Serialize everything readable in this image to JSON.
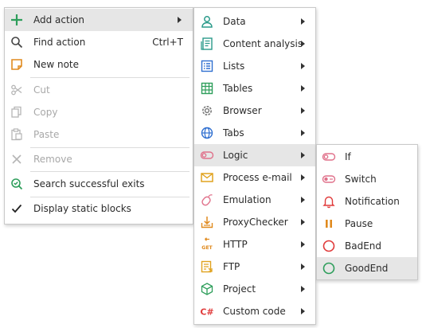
{
  "main_menu": {
    "add_action": "Add action",
    "find_action": "Find action",
    "find_action_shortcut": "Ctrl+T",
    "new_note": "New note",
    "cut": "Cut",
    "copy": "Copy",
    "paste": "Paste",
    "remove": "Remove",
    "search_successful_exits": "Search successful exits",
    "display_static_blocks": "Display static blocks"
  },
  "action_menu": {
    "items": [
      {
        "label": "Data",
        "icon": "person-icon"
      },
      {
        "label": "Content analysis",
        "icon": "document-analysis-icon"
      },
      {
        "label": "Lists",
        "icon": "list-icon"
      },
      {
        "label": "Tables",
        "icon": "table-icon"
      },
      {
        "label": "Browser",
        "icon": "gear-icon"
      },
      {
        "label": "Tabs",
        "icon": "globe-icon"
      },
      {
        "label": "Logic",
        "icon": "toggle-icon"
      },
      {
        "label": "Process e-mail",
        "icon": "envelope-icon"
      },
      {
        "label": "Emulation",
        "icon": "mouse-icon"
      },
      {
        "label": "ProxyChecker",
        "icon": "proxy-download-icon"
      },
      {
        "label": "HTTP",
        "icon": "http-get-icon"
      },
      {
        "label": "FTP",
        "icon": "ftp-icon"
      },
      {
        "label": "Project",
        "icon": "cube-icon"
      },
      {
        "label": "Custom code",
        "icon": "csharp-icon"
      }
    ],
    "get_badge": "GET",
    "csharp_badge": "C#"
  },
  "logic_menu": {
    "items": [
      {
        "label": "If",
        "icon": "toggle-icon"
      },
      {
        "label": "Switch",
        "icon": "switch-icon"
      },
      {
        "label": "Notification",
        "icon": "bell-icon"
      },
      {
        "label": "Pause",
        "icon": "pause-icon"
      },
      {
        "label": "BadEnd",
        "icon": "red-circle-icon"
      },
      {
        "label": "GoodEnd",
        "icon": "green-circle-icon"
      }
    ]
  },
  "colors": {
    "highlight": "#e6e6e6",
    "green": "#2e9e5b",
    "teal": "#2a9a8a",
    "blue": "#2f6fd0",
    "orange": "#e08a1e",
    "red": "#e03a3a",
    "pink": "#e0708a",
    "disabled": "#a8a8a8"
  }
}
